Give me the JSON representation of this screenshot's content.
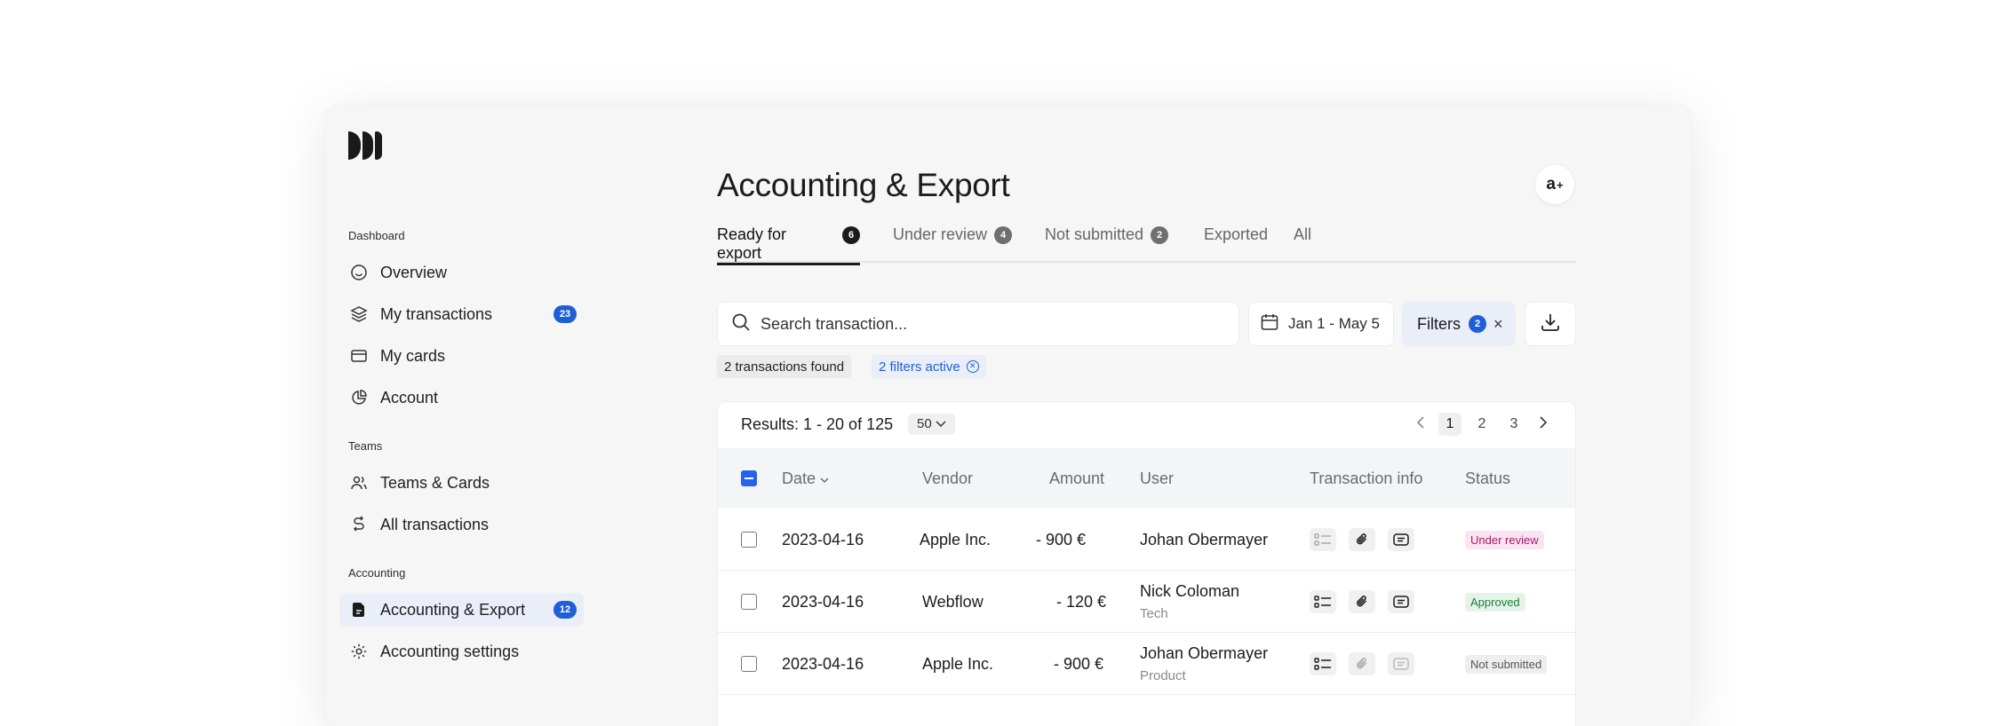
{
  "sidebar": {
    "sections": [
      {
        "label": "Dashboard"
      },
      {
        "label": "Teams"
      },
      {
        "label": "Accounting"
      }
    ],
    "items": [
      {
        "label": "Overview",
        "icon": "smile-icon"
      },
      {
        "label": "My transactions",
        "icon": "layers-icon",
        "badge": "23"
      },
      {
        "label": "My cards",
        "icon": "card-icon"
      },
      {
        "label": "Account",
        "icon": "pie-chart-icon"
      },
      {
        "label": "Teams & Cards",
        "icon": "users-icon"
      },
      {
        "label": "All transactions",
        "icon": "transfer-icon"
      },
      {
        "label": "Accounting & Export",
        "icon": "document-icon",
        "badge": "12",
        "active": true
      },
      {
        "label": "Accounting settings",
        "icon": "gear-icon"
      }
    ]
  },
  "header": {
    "title": "Accounting & Export",
    "avatar": "a",
    "avatar_sup": "+"
  },
  "tabs": [
    {
      "label": "Ready for export",
      "count": "6"
    },
    {
      "label": "Under review",
      "count": "4"
    },
    {
      "label": "Not submitted",
      "count": "2"
    },
    {
      "label": "Exported"
    },
    {
      "label": "All"
    }
  ],
  "toolbar": {
    "search_placeholder": "Search transaction...",
    "date_range": "Jan 1 - May 5",
    "filters_label": "Filters",
    "filters_count": "2",
    "filters_clear": "×"
  },
  "chips": {
    "found": "2 transactions found",
    "active": "2 filters active"
  },
  "results": {
    "summary": "Results: 1 - 20 of 125",
    "per_page": "50",
    "pages": [
      "1",
      "2",
      "3"
    ],
    "columns": {
      "date": "Date",
      "vendor": "Vendor",
      "amount": "Amount",
      "user": "User",
      "info": "Transaction info",
      "status": "Status"
    },
    "rows": [
      {
        "date": "2023-04-16",
        "vendor": "Apple Inc.",
        "amount": "- 900 €",
        "user": "Johan Obermayer",
        "dept": "",
        "status": "Under review"
      },
      {
        "date": "2023-04-16",
        "vendor": "Webflow",
        "amount": "- 120 €",
        "user": "Nick Coloman",
        "dept": "Tech",
        "status": "Approved"
      },
      {
        "date": "2023-04-16",
        "vendor": "Apple Inc.",
        "amount": "- 900 €",
        "user": "Johan Obermayer",
        "dept": "Product",
        "status": "Not submitted"
      }
    ]
  },
  "colors": {
    "accent": "#1f5fd6",
    "checkbox": "#2563eb",
    "review_bg": "#fbe4f1",
    "approved_bg": "#e3f5e8"
  }
}
